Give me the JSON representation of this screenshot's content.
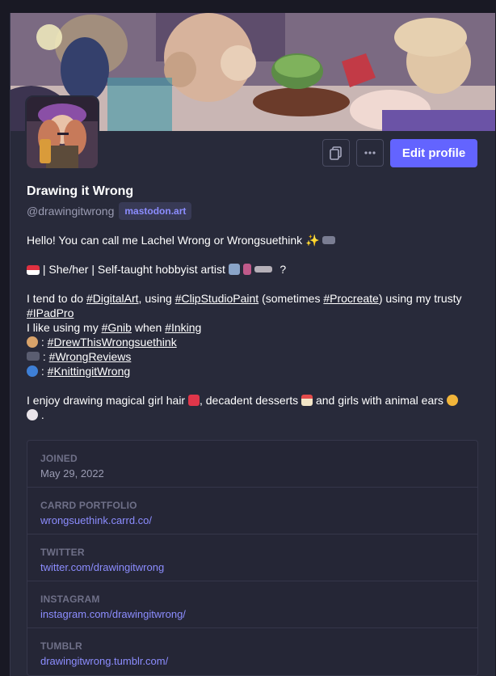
{
  "profile": {
    "display_name": "Drawing it Wrong",
    "handle": "@drawingitwrong",
    "domain": "mastodon.art",
    "edit_label": "Edit profile"
  },
  "bio": {
    "line1": "Hello! You can call me Lachel Wrong or Wrongsuethink",
    "line2_text": " | She/her | Self-taught hobbyist artist",
    "line2_tail": "?",
    "p2_a": "I tend to do ",
    "tag_digitalart": "#DigitalArt",
    "p2_b": ", using ",
    "tag_clipstudio": "#ClipStudioPaint",
    "p2_c": " (sometimes ",
    "tag_procreate": "#Procreate",
    "p2_d": ") using my trusty ",
    "tag_ipadpro": "#IPadPro",
    "p3_a": "I like using my ",
    "tag_gnib": "#Gnib",
    "p3_b": " when ",
    "tag_inking": "#Inking",
    "colon": " : ",
    "tag_drew": "#DrewThisWrongsuethink",
    "tag_reviews": "#WrongReviews",
    "tag_knitting": "#KnittingitWrong",
    "p4_a": "I enjoy drawing magical girl hair",
    "p4_b": ", decadent desserts",
    "p4_c": " and girls with animal ears",
    "p4_d": "."
  },
  "fields": [
    {
      "label": "JOINED",
      "value": "May 29, 2022"
    },
    {
      "label": "CARRD PORTFOLIO",
      "value": "wrongsuethink.carrd.co/"
    },
    {
      "label": "TWITTER",
      "value": "twitter.com/drawingitwrong"
    },
    {
      "label": "INSTAGRAM",
      "value": "instagram.com/drawingitwrong/"
    },
    {
      "label": "TUMBLR",
      "value": "drawingitwrong.tumblr.com/"
    }
  ],
  "icons": {
    "copy": "copy-icon",
    "more": "ellipsis-icon"
  },
  "colors": {
    "accent": "#6364ff",
    "link": "#8c8dff",
    "background": "#282a3a"
  }
}
